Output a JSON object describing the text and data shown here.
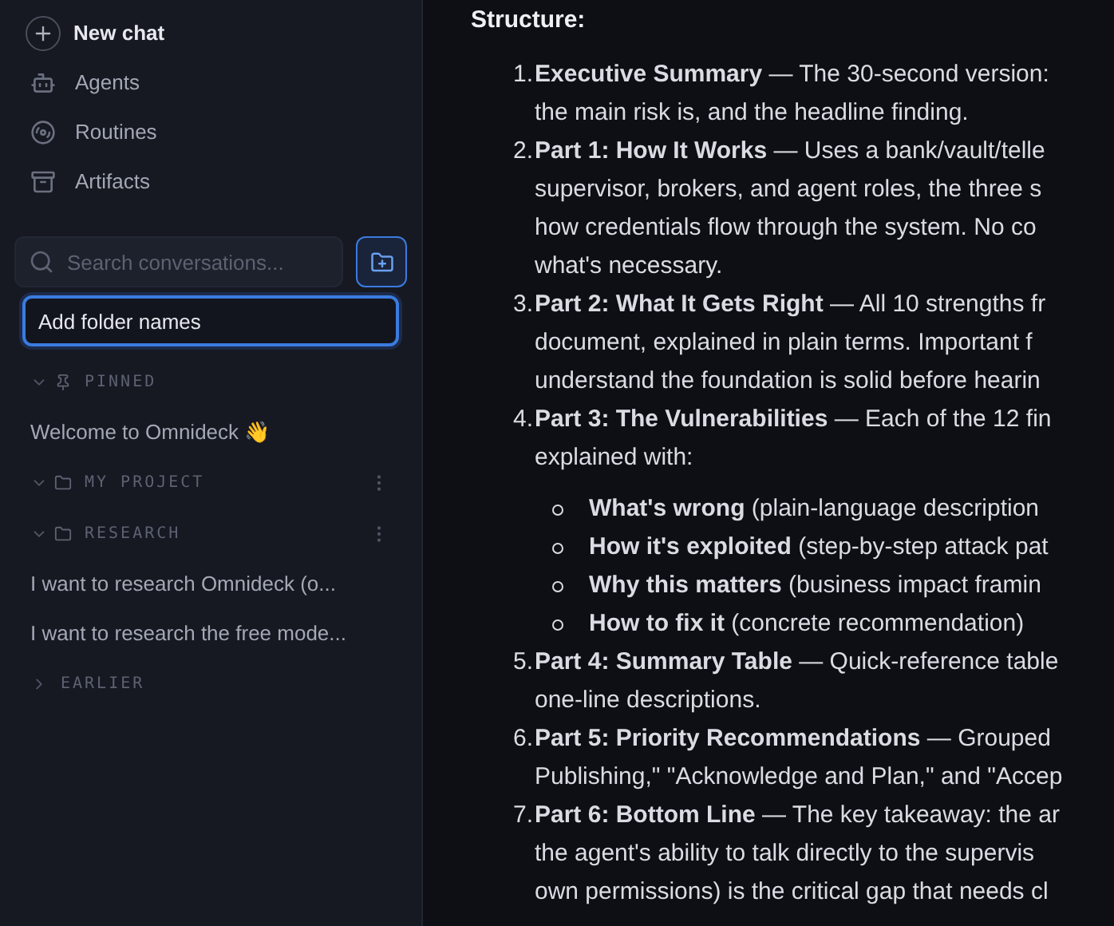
{
  "sidebar": {
    "nav": [
      {
        "kind": "new",
        "label": "New chat"
      },
      {
        "kind": "agents",
        "label": "Agents"
      },
      {
        "kind": "routines",
        "label": "Routines"
      },
      {
        "kind": "artifacts",
        "label": "Artifacts"
      }
    ],
    "search": {
      "placeholder": "Search conversations..."
    },
    "folder_name_input": {
      "value": "Add folder names"
    },
    "sections": [
      {
        "kind": "pinned",
        "title": "PINNED",
        "expanded": true,
        "chats": [
          "Welcome to Omnideck 👋"
        ]
      },
      {
        "kind": "folder",
        "title": "MY PROJECT",
        "expanded": true
      },
      {
        "kind": "folder",
        "title": "RESEARCH",
        "expanded": true,
        "chats": [
          "I want to research Omnideck (o...",
          "I want to research the free mode..."
        ]
      },
      {
        "kind": "plain",
        "title": "EARLIER",
        "expanded": false
      }
    ]
  },
  "content": {
    "heading": "Structure:",
    "items": [
      {
        "number": "1.",
        "lines": [
          "**Executive Summary** — The 30-second version:",
          "the main risk is, and the headline finding."
        ]
      },
      {
        "number": "2.",
        "lines": [
          "**Part 1: How It Works** — Uses a bank/vault/telle",
          "supervisor, brokers, and agent roles, the three s",
          "how credentials flow through the system. No co",
          "what's necessary."
        ]
      },
      {
        "number": "3.",
        "lines": [
          "**Part 2: What It Gets Right** — All 10 strengths fr",
          "document, explained in plain terms. Important f",
          "understand the foundation is solid before hearin"
        ]
      },
      {
        "number": "4.",
        "lines": [
          "**Part 3: The Vulnerabilities** — Each of the 12 fin",
          "explained with:"
        ],
        "subitems": [
          "**What's wrong** (plain-language description",
          "**How it's exploited** (step-by-step attack pat",
          "**Why this matters** (business impact framin",
          "**How to fix it** (concrete recommendation)"
        ]
      },
      {
        "number": "5.",
        "lines": [
          "**Part 4: Summary Table** — Quick-reference table",
          "one-line descriptions."
        ]
      },
      {
        "number": "6.",
        "lines": [
          "**Part 5: Priority Recommendations** — Grouped",
          "Publishing,\" \"Acknowledge and Plan,\" and \"Accep"
        ]
      },
      {
        "number": "7.",
        "lines": [
          "**Part 6: Bottom Line** — The key takeaway: the ar",
          "the agent's ability to talk directly to the supervis",
          "own permissions) is the critical gap that needs cl"
        ]
      }
    ]
  }
}
